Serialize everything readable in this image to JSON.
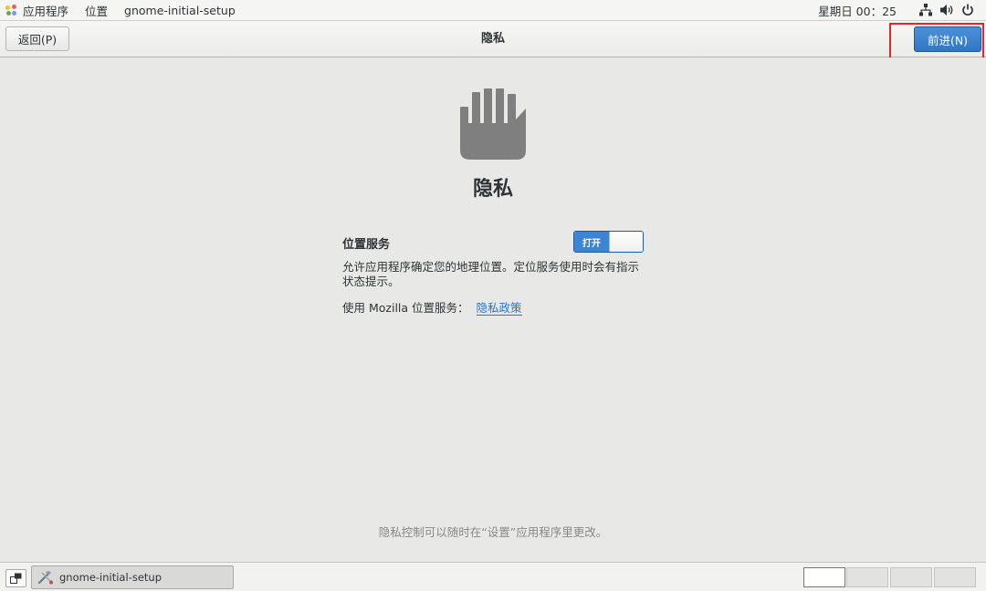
{
  "top_panel": {
    "apps_menu": "应用程序",
    "places_menu": "位置",
    "app_name": "gnome-initial-setup",
    "clock": "星期日 00：25",
    "icons": [
      "network-icon",
      "volume-icon",
      "power-icon"
    ]
  },
  "header": {
    "back_label": "返回(P)",
    "title": "隐私",
    "next_label": "前进(N)"
  },
  "main": {
    "icon": "hand-icon",
    "heading": "隐私",
    "location": {
      "label": "位置服务",
      "toggle_state": "打开",
      "enabled": true,
      "description": "允许应用程序确定您的地理位置。定位服务使用时会有指示状态提示。",
      "mozilla_text": "使用 Mozilla 位置服务：",
      "policy_link": "隐私政策"
    },
    "footer_note": "隐私控制可以随时在“设置”应用程序里更改。"
  },
  "taskbar": {
    "task_label": "gnome-initial-setup",
    "workspaces": [
      {
        "active": true
      },
      {
        "active": false
      },
      {
        "active": false
      },
      {
        "active": false
      }
    ]
  },
  "colors": {
    "accent": "#3d84d3",
    "link": "#2a76c6",
    "highlight": "#e0282b"
  }
}
